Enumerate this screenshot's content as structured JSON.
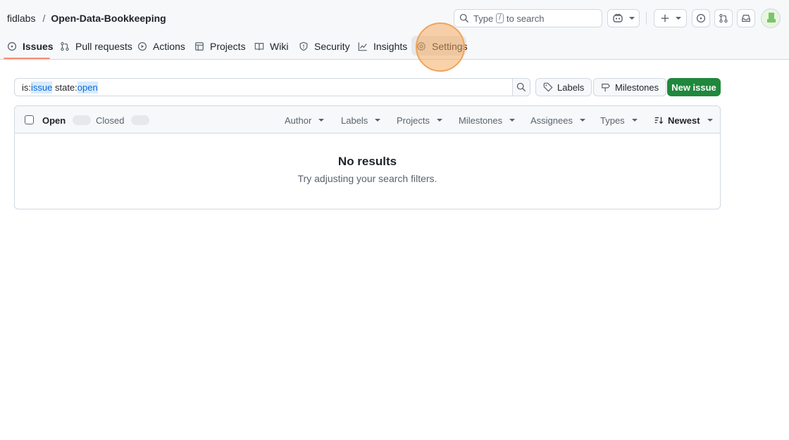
{
  "breadcrumb": {
    "owner": "fidlabs",
    "separator": "/",
    "repo": "Open-Data-Bookkeeping"
  },
  "search": {
    "prefix": "Type",
    "key": "/",
    "suffix": "to search"
  },
  "header_buttons": [
    "copilot-icon",
    "plus-icon",
    "issue-opened-icon",
    "pull-request-icon",
    "inbox-icon"
  ],
  "tabs": [
    {
      "label": "Issues",
      "icon": "issue-opened-icon",
      "active": true
    },
    {
      "label": "Pull requests",
      "icon": "pull-request-icon"
    },
    {
      "label": "Actions",
      "icon": "play-icon"
    },
    {
      "label": "Projects",
      "icon": "table-icon"
    },
    {
      "label": "Wiki",
      "icon": "book-icon"
    },
    {
      "label": "Security",
      "icon": "shield-icon"
    },
    {
      "label": "Insights",
      "icon": "graph-icon"
    },
    {
      "label": "Settings",
      "icon": "gear-icon",
      "highlighted": true
    }
  ],
  "filter": {
    "tokens": [
      {
        "text": "is:",
        "hl": false
      },
      {
        "text": "issue",
        "hl": true
      },
      {
        "text": " state:",
        "hl": false
      },
      {
        "text": "open",
        "hl": true
      }
    ]
  },
  "actions": {
    "labels": "Labels",
    "milestones": "Milestones",
    "new_issue": "New issue"
  },
  "list_header": {
    "open": "Open",
    "closed": "Closed",
    "filters": [
      "Author",
      "Labels",
      "Projects",
      "Milestones",
      "Assignees",
      "Types"
    ],
    "sort": "Newest"
  },
  "empty": {
    "title": "No results",
    "subtitle": "Try adjusting your search filters."
  },
  "colors": {
    "accent": "#1f883d",
    "tab_underline": "#fd8c73",
    "highlight_ring": "#f0a45a",
    "link": "#0969da"
  }
}
